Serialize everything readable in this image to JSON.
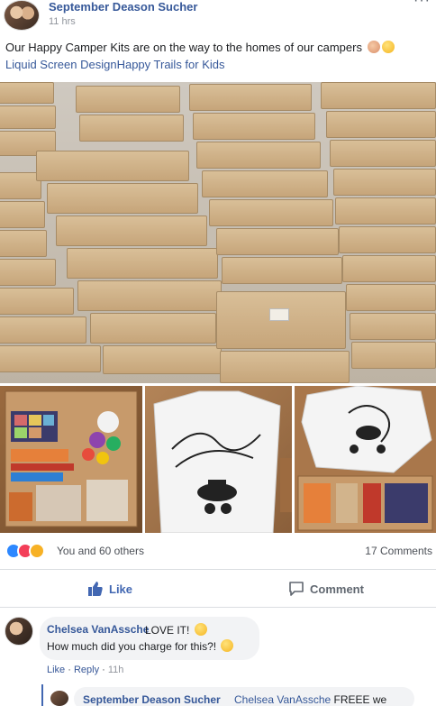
{
  "post": {
    "author": "September Deason Sucher",
    "time": "11 hrs",
    "text": "Our Happy Camper Kits are on the way to the homes of our campers",
    "tags": "Liquid Screen DesignHappy Trails for Kids"
  },
  "reactions": {
    "text": "You and 60 others",
    "comments": "17 Comments"
  },
  "actions": {
    "like": "Like",
    "comment": "Comment"
  },
  "comment": {
    "author": "Chelsea VanAssche",
    "line1": "LOVE IT!",
    "line2": "How much did you charge for this?!",
    "like": "Like",
    "reply": "Reply",
    "time": "11h"
  },
  "reply": {
    "author": "September Deason Sucher",
    "mention": "Chelsea VanAssche",
    "text": "FREEE we"
  },
  "colors": {
    "link": "#365899",
    "like_blue": "#4267b2",
    "bubble": "#f2f3f5"
  }
}
